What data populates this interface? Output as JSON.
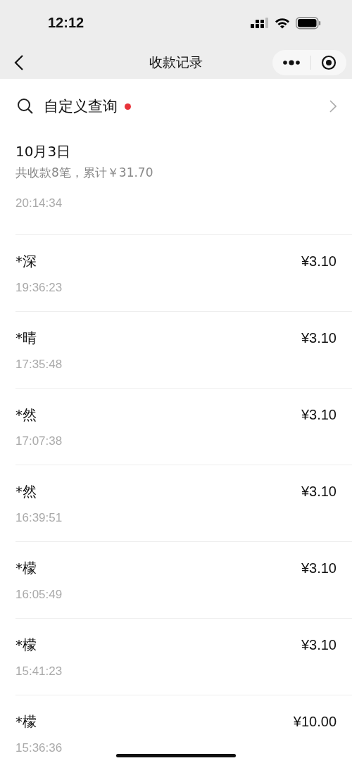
{
  "status_bar": {
    "time": "12:12"
  },
  "nav": {
    "title": "收款记录"
  },
  "search": {
    "label": "自定义查询",
    "unread": true
  },
  "group": {
    "date": "10月3日",
    "summary": "共收款8笔，累计￥31.70"
  },
  "records": [
    {
      "time": "20:14:34"
    },
    {
      "name": "*深",
      "time": "19:36:23",
      "amount": "¥3.10"
    },
    {
      "name": "*晴",
      "time": "17:35:48",
      "amount": "¥3.10"
    },
    {
      "name": "*然",
      "time": "17:07:38",
      "amount": "¥3.10"
    },
    {
      "name": "*然",
      "time": "16:39:51",
      "amount": "¥3.10"
    },
    {
      "name": "*檬",
      "time": "16:05:49",
      "amount": "¥3.10"
    },
    {
      "name": "*檬",
      "time": "15:41:23",
      "amount": "¥3.10"
    },
    {
      "name": "*檬",
      "time": "15:36:36",
      "amount": "¥10.00"
    }
  ]
}
